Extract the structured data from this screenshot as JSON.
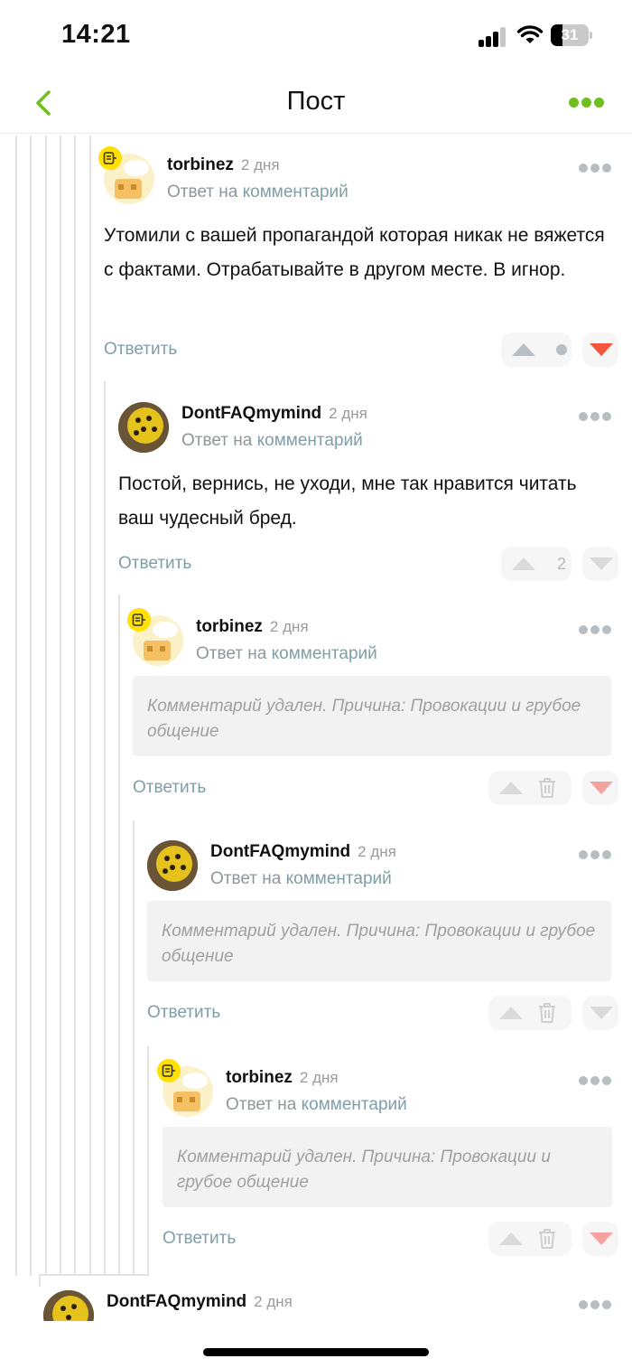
{
  "status": {
    "time": "14:21",
    "battery": "31",
    "battery_level": 0.31
  },
  "nav": {
    "title": "Пост"
  },
  "comments": [
    {
      "author": "torbinez",
      "time": "2 дня",
      "reply_prefix": "Ответ на",
      "reply_link": "комментарий",
      "body": "Утомили с вашей пропагандой которая никак не вяжется с фактами. Отрабатывайте в другом месте. В игнор.",
      "reply_label": "Ответить",
      "rating": "",
      "avatar": "torbinez-avatar"
    },
    {
      "author": "DontFAQmymind",
      "time": "2 дня",
      "reply_prefix": "Ответ на",
      "reply_link": "комментарий",
      "body": "Постой, вернись, не уходи, мне так нравится читать ваш чудесный бред.",
      "reply_label": "Ответить",
      "rating": "2",
      "avatar": "dontfaq-avatar"
    },
    {
      "author": "torbinez",
      "time": "2 дня",
      "reply_prefix": "Ответ на",
      "reply_link": "комментарий",
      "deleted": "Комментарий удален. Причина: Провокации и грубое общение",
      "reply_label": "Ответить",
      "avatar": "torbinez-avatar"
    },
    {
      "author": "DontFAQmymind",
      "time": "2 дня",
      "reply_prefix": "Ответ на",
      "reply_link": "комментарий",
      "deleted": "Комментарий удален. Причина: Провокации и грубое общение",
      "reply_label": "Ответить",
      "avatar": "dontfaq-avatar"
    },
    {
      "author": "torbinez",
      "time": "2 дня",
      "reply_prefix": "Ответ на",
      "reply_link": "комментарий",
      "deleted": "Комментарий удален. Причина: Провокации и грубое общение",
      "reply_label": "Ответить",
      "avatar": "torbinez-avatar"
    },
    {
      "author": "DontFAQmymind",
      "time": "2 дня",
      "avatar": "dontfaq-avatar"
    }
  ],
  "colors": {
    "accent": "#6fbf1f",
    "downvote_active": "#f4543c",
    "downvote_soft": "#f4a3a0",
    "link": "#7f9ea6"
  }
}
